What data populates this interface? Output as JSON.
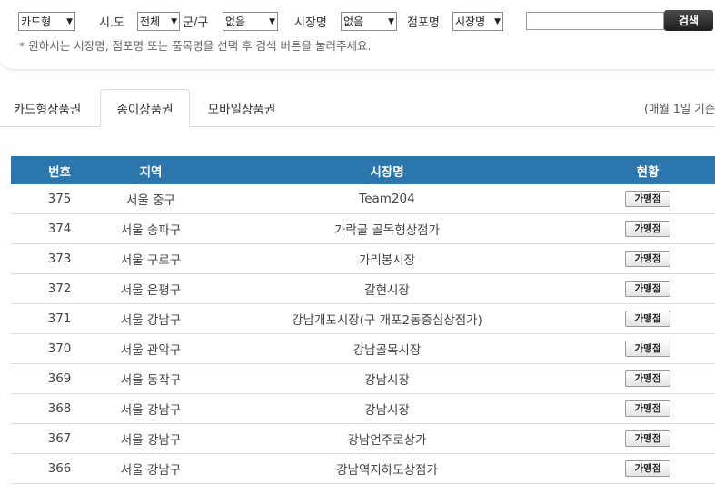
{
  "filters": {
    "card_type": {
      "value": "카드형"
    },
    "sido": {
      "label": "시.도",
      "value": "전체"
    },
    "gugun": {
      "label": "군/구",
      "value": "없음"
    },
    "market": {
      "label": "시장명",
      "value": "없음"
    },
    "store": {
      "label": "점포명",
      "value": "시장명"
    },
    "search_query": "",
    "search_button": "검색",
    "hint": "* 원하시는 시장명, 점포명 또는 품목명을 선택 후 검색 버튼을 눌러주세요."
  },
  "tabs": [
    {
      "label": "카드형상품권",
      "active": false
    },
    {
      "label": "종이상품권",
      "active": true
    },
    {
      "label": "모바일상품권",
      "active": false
    }
  ],
  "notice": "(매월 1일 기준",
  "table": {
    "headers": [
      "번호",
      "지역",
      "시장명",
      "현황"
    ],
    "rows": [
      {
        "no": "375",
        "region": "서울 중구",
        "market": "Team204",
        "status": "가맹점"
      },
      {
        "no": "374",
        "region": "서울 송파구",
        "market": "가락골 골목형상점가",
        "status": "가맹점"
      },
      {
        "no": "373",
        "region": "서울 구로구",
        "market": "가리봉시장",
        "status": "가맹점"
      },
      {
        "no": "372",
        "region": "서울 은평구",
        "market": "갈현시장",
        "status": "가맹점"
      },
      {
        "no": "371",
        "region": "서울 강남구",
        "market": "강남개포시장(구 개포2동중심상점가)",
        "status": "가맹점"
      },
      {
        "no": "370",
        "region": "서울 관악구",
        "market": "강남골목시장",
        "status": "가맹점"
      },
      {
        "no": "369",
        "region": "서울 동작구",
        "market": "강남시장",
        "status": "가맹점"
      },
      {
        "no": "368",
        "region": "서울 강남구",
        "market": "강남시장",
        "status": "가맹점"
      },
      {
        "no": "367",
        "region": "서울 강남구",
        "market": "강남언주로상가",
        "status": "가맹점"
      },
      {
        "no": "366",
        "region": "서울 강남구",
        "market": "강남역지하도상점가",
        "status": "가맹점"
      }
    ]
  },
  "colors": {
    "header_bg": "#2b76ad",
    "search_button_bg": "#2a2a2a"
  }
}
